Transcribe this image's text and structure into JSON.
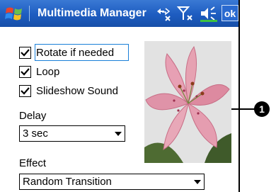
{
  "titlebar": {
    "title": "Multimedia Manager",
    "ok_label": "ok",
    "icons": [
      "windows-start-icon",
      "connectivity-icon",
      "signal-icon",
      "volume-icon"
    ]
  },
  "options": {
    "checkboxes": [
      {
        "label": "Rotate if needed",
        "checked": true
      },
      {
        "label": "Loop",
        "checked": true
      },
      {
        "label": "Slideshow Sound",
        "checked": true
      }
    ],
    "delay": {
      "label": "Delay",
      "value": "3 sec"
    },
    "effect": {
      "label": "Effect",
      "value": "Random Transition"
    }
  },
  "preview": {
    "subject": "pink-lily-flower"
  },
  "callout": {
    "number": "1"
  },
  "colors": {
    "titlebar": "#1d5cc0",
    "focus": "#1a7fd8",
    "flower": "#d9788f"
  }
}
